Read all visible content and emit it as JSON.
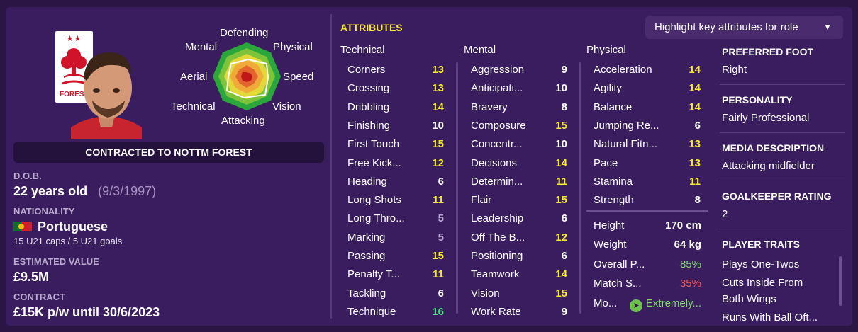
{
  "player": {
    "contract_banner": "CONTRACTED TO NOTTM FOREST",
    "dob_label": "D.O.B.",
    "age": "22 years old",
    "dob": "(9/3/1997)",
    "nationality_label": "NATIONALITY",
    "nationality": "Portuguese",
    "caps": "15 U21 caps / 5 U21 goals",
    "value_label": "ESTIMATED VALUE",
    "value": "£9.5M",
    "contract_label": "CONTRACT",
    "contract": "£15K p/w until 30/6/2023",
    "club_badge": "nottm-forest-badge",
    "flag_colors": [
      "#0a6e2b",
      "#d2202a",
      "#f2c20a"
    ]
  },
  "radar": {
    "labels": {
      "defending": "Defending",
      "physical": "Physical",
      "speed": "Speed",
      "vision": "Vision",
      "attacking": "Attacking",
      "technical": "Technical",
      "aerial": "Aerial",
      "mental": "Mental"
    }
  },
  "attributes": {
    "title": "ATTRIBUTES",
    "highlight_button": "Highlight key attributes for role",
    "technical_header": "Technical",
    "mental_header": "Mental",
    "physical_header": "Physical",
    "technical": [
      {
        "name": "Corners",
        "value": "13"
      },
      {
        "name": "Crossing",
        "value": "13"
      },
      {
        "name": "Dribbling",
        "value": "14"
      },
      {
        "name": "Finishing",
        "value": "10"
      },
      {
        "name": "First Touch",
        "value": "15"
      },
      {
        "name": "Free Kick...",
        "value": "12"
      },
      {
        "name": "Heading",
        "value": "6"
      },
      {
        "name": "Long Shots",
        "value": "11"
      },
      {
        "name": "Long Thro...",
        "value": "5"
      },
      {
        "name": "Marking",
        "value": "5"
      },
      {
        "name": "Passing",
        "value": "15"
      },
      {
        "name": "Penalty T...",
        "value": "11"
      },
      {
        "name": "Tackling",
        "value": "6"
      },
      {
        "name": "Technique",
        "value": "16"
      }
    ],
    "mental": [
      {
        "name": "Aggression",
        "value": "9"
      },
      {
        "name": "Anticipati...",
        "value": "10"
      },
      {
        "name": "Bravery",
        "value": "8"
      },
      {
        "name": "Composure",
        "value": "15"
      },
      {
        "name": "Concentr...",
        "value": "10"
      },
      {
        "name": "Decisions",
        "value": "14"
      },
      {
        "name": "Determin...",
        "value": "11"
      },
      {
        "name": "Flair",
        "value": "15"
      },
      {
        "name": "Leadership",
        "value": "6"
      },
      {
        "name": "Off The B...",
        "value": "12"
      },
      {
        "name": "Positioning",
        "value": "6"
      },
      {
        "name": "Teamwork",
        "value": "14"
      },
      {
        "name": "Vision",
        "value": "15"
      },
      {
        "name": "Work Rate",
        "value": "9"
      }
    ],
    "physical": [
      {
        "name": "Acceleration",
        "value": "14"
      },
      {
        "name": "Agility",
        "value": "14"
      },
      {
        "name": "Balance",
        "value": "14"
      },
      {
        "name": "Jumping Re...",
        "value": "6"
      },
      {
        "name": "Natural Fitn...",
        "value": "13"
      },
      {
        "name": "Pace",
        "value": "13"
      },
      {
        "name": "Stamina",
        "value": "11"
      },
      {
        "name": "Strength",
        "value": "8"
      }
    ],
    "details": [
      {
        "name": "Height",
        "value": "170 cm"
      },
      {
        "name": "Weight",
        "value": "64 kg"
      },
      {
        "name": "Overall P...",
        "value": "85%"
      },
      {
        "name": "Match S...",
        "value": "35%"
      },
      {
        "name": "Mo...",
        "value": "Extremely..."
      }
    ]
  },
  "colors": {
    "low": "#bba8d4",
    "mid": "#ffffff",
    "good": "#f4e92f",
    "great": "#4fe07a",
    "green_text": "#7fd96b",
    "red_text": "#ef5a5a"
  },
  "info": {
    "foot_label": "PREFERRED FOOT",
    "foot": "Right",
    "personality_label": "PERSONALITY",
    "personality": "Fairly Professional",
    "media_label": "MEDIA DESCRIPTION",
    "media": "Attacking midfielder",
    "gk_label": "GOALKEEPER RATING",
    "gk": "2",
    "traits_label": "PLAYER TRAITS",
    "traits": [
      "Plays One-Twos",
      "Cuts Inside From",
      "Both Wings",
      "Runs With Ball Oft..."
    ]
  }
}
